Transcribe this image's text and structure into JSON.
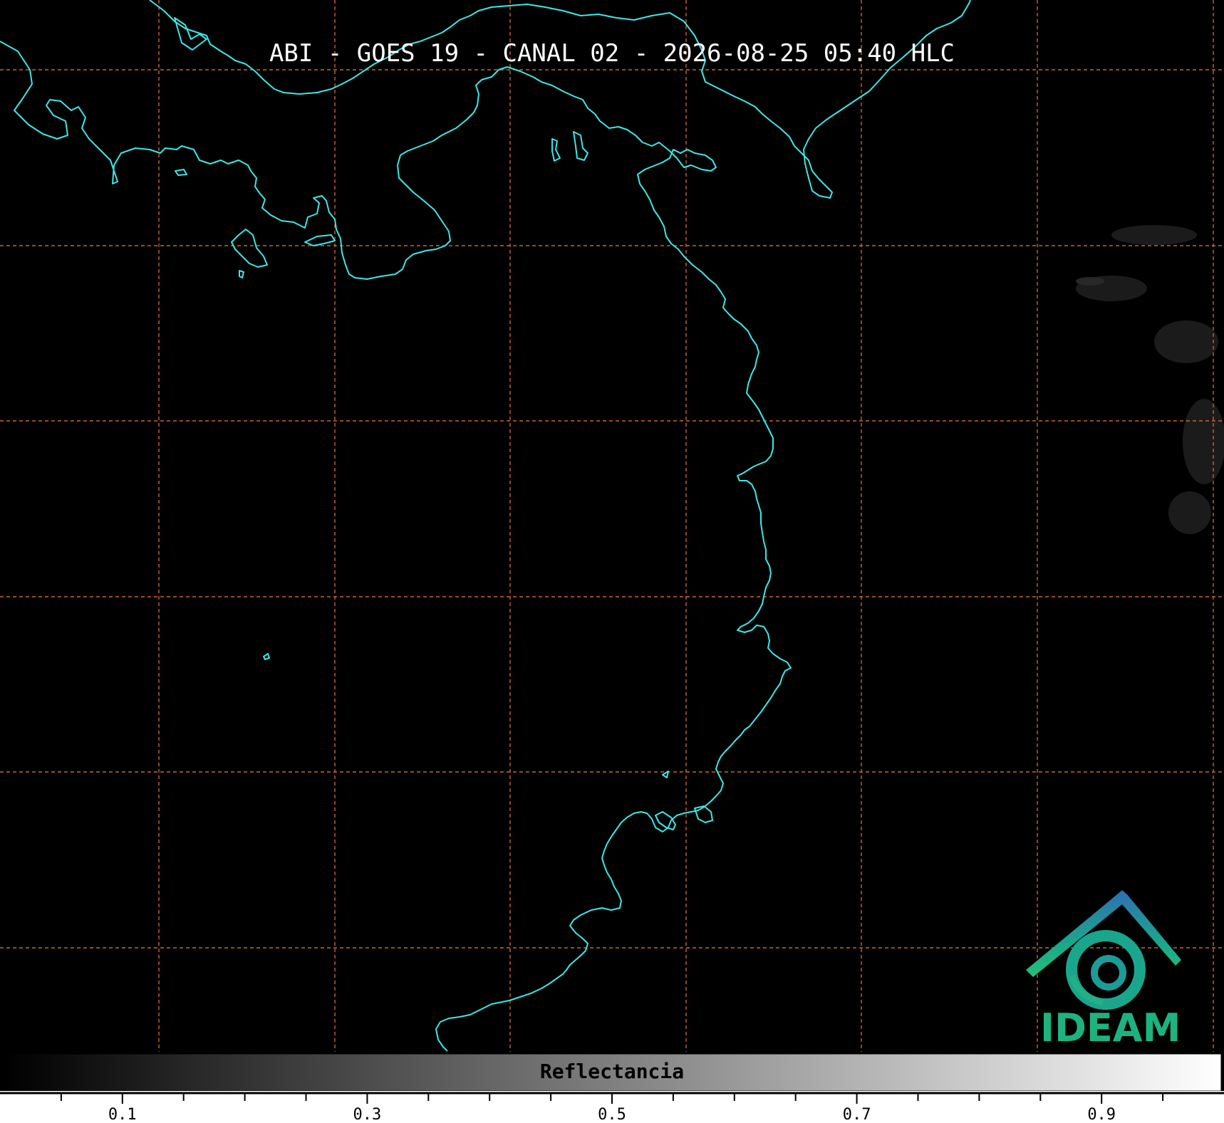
{
  "map": {
    "title": "ABI - GOES 19 - CANAL 02 - 2026-08-25 05:40 HLC",
    "coastline_color": "#3ee6e6",
    "gridline_color": "#c86432",
    "background_color": "#000000"
  },
  "colorbar": {
    "label": "Reflectancia",
    "ticks": [
      "0.1",
      "0.3",
      "0.5",
      "0.7",
      "0.9"
    ],
    "range": [
      0,
      1
    ],
    "gradient": [
      "#000000",
      "#ffffff"
    ]
  },
  "logo": {
    "text": "IDEAM",
    "colors": [
      "#2f6fb4",
      "#1aa68c",
      "#23c07a"
    ]
  }
}
